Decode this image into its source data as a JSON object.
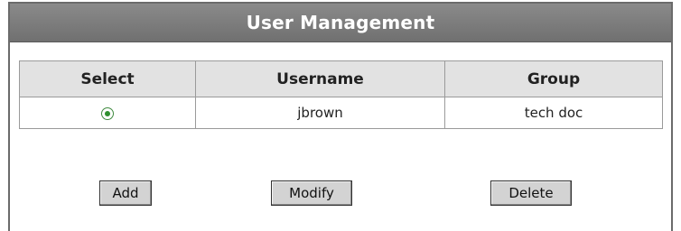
{
  "panel": {
    "title": "User Management"
  },
  "table": {
    "headers": [
      "Select",
      "Username",
      "Group"
    ],
    "rows": [
      {
        "selected": true,
        "username": "jbrown",
        "group": "tech doc"
      }
    ]
  },
  "buttons": {
    "add": "Add",
    "modify": "Modify",
    "delete": "Delete"
  },
  "colors": {
    "header_bg": "#7d7d7d",
    "radio_accent": "#2d8f2d"
  }
}
